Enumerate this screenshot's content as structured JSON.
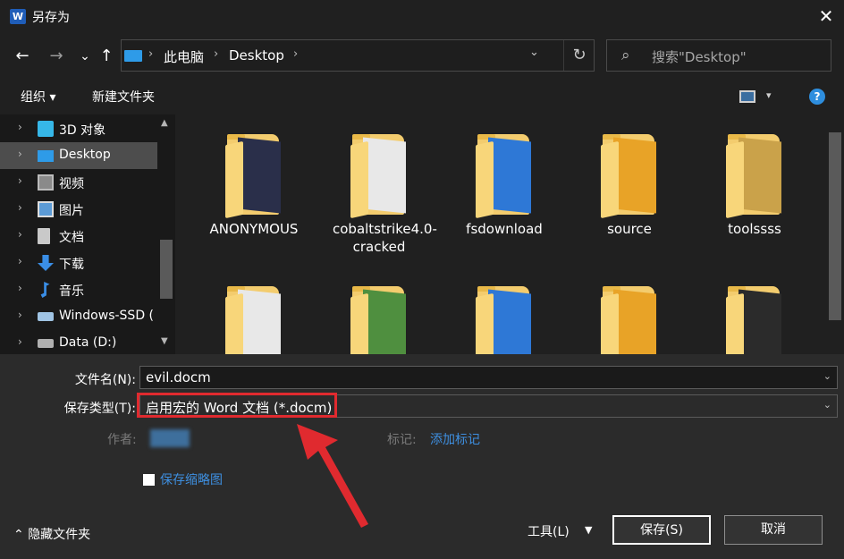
{
  "window": {
    "app_icon": "W",
    "title": "另存为",
    "close_glyph": "✕"
  },
  "nav": {
    "back_glyph": "←",
    "forward_glyph": "→",
    "recent_glyph": "⌄",
    "up_glyph": "↑",
    "breadcrumbs": [
      "此电脑",
      "Desktop"
    ],
    "separator": "›",
    "dropdown_glyph": "⌄",
    "refresh_glyph": "↻",
    "search_placeholder": "搜索\"Desktop\""
  },
  "toolbar": {
    "organize_label": "组织 ▾",
    "new_folder_label": "新建文件夹",
    "view_caret": "▾",
    "help_glyph": "?"
  },
  "sidebar": {
    "items": [
      {
        "label": "3D 对象",
        "icon": "cube-icon",
        "color": "#36b7e8",
        "selected": false
      },
      {
        "label": "Desktop",
        "icon": "desktop-icon",
        "color": "#2e9be8",
        "selected": true
      },
      {
        "label": "视频",
        "icon": "video-icon",
        "color": "#8a8a8a",
        "selected": false
      },
      {
        "label": "图片",
        "icon": "pictures-icon",
        "color": "#5c9bd6",
        "selected": false
      },
      {
        "label": "文档",
        "icon": "documents-icon",
        "color": "#c9c9c9",
        "selected": false
      },
      {
        "label": "下载",
        "icon": "download-icon",
        "color": "#3a8ee6",
        "selected": false
      },
      {
        "label": "音乐",
        "icon": "music-icon",
        "color": "#3a8ee6",
        "selected": false
      },
      {
        "label": "Windows-SSD (",
        "icon": "drive-icon",
        "color": "#a0c4e4",
        "selected": false
      },
      {
        "label": "Data (D:)",
        "icon": "drive-icon",
        "color": "#b0b0b0",
        "selected": false
      }
    ],
    "chevron": "›"
  },
  "files": [
    {
      "name": "ANONYMOUS",
      "accent": "#2a2f4a"
    },
    {
      "name": "cobaltstrike4.0-\ncracked",
      "accent": "#e8e8e8"
    },
    {
      "name": "fsdownload",
      "accent": "#2e78d6"
    },
    {
      "name": "source",
      "accent": "#e8a327"
    },
    {
      "name": "toolssss",
      "accent": "#caa24a"
    },
    {
      "name": "",
      "accent": "#e8e8e8"
    },
    {
      "name": "",
      "accent": "#4f8f3f"
    },
    {
      "name": "",
      "accent": "#2e78d6"
    },
    {
      "name": "",
      "accent": "#e8a327"
    },
    {
      "name": "",
      "accent": "#2b2b2b"
    }
  ],
  "form": {
    "filename_label": "文件名(N):",
    "filename_value": "evil.docm",
    "type_label": "保存类型(T):",
    "type_value": "启用宏的 Word 文档 (*.docm)",
    "author_label": "作者:",
    "tags_label": "标记:",
    "tags_link": "添加标记",
    "thumbnail_label": "保存缩略图",
    "hide_folders_label": "隐藏文件夹",
    "tools_label": "工具(L)",
    "save_label": "保存(S)",
    "cancel_label": "取消",
    "caret": "⌄",
    "annotation_color": "#e02a2f"
  }
}
